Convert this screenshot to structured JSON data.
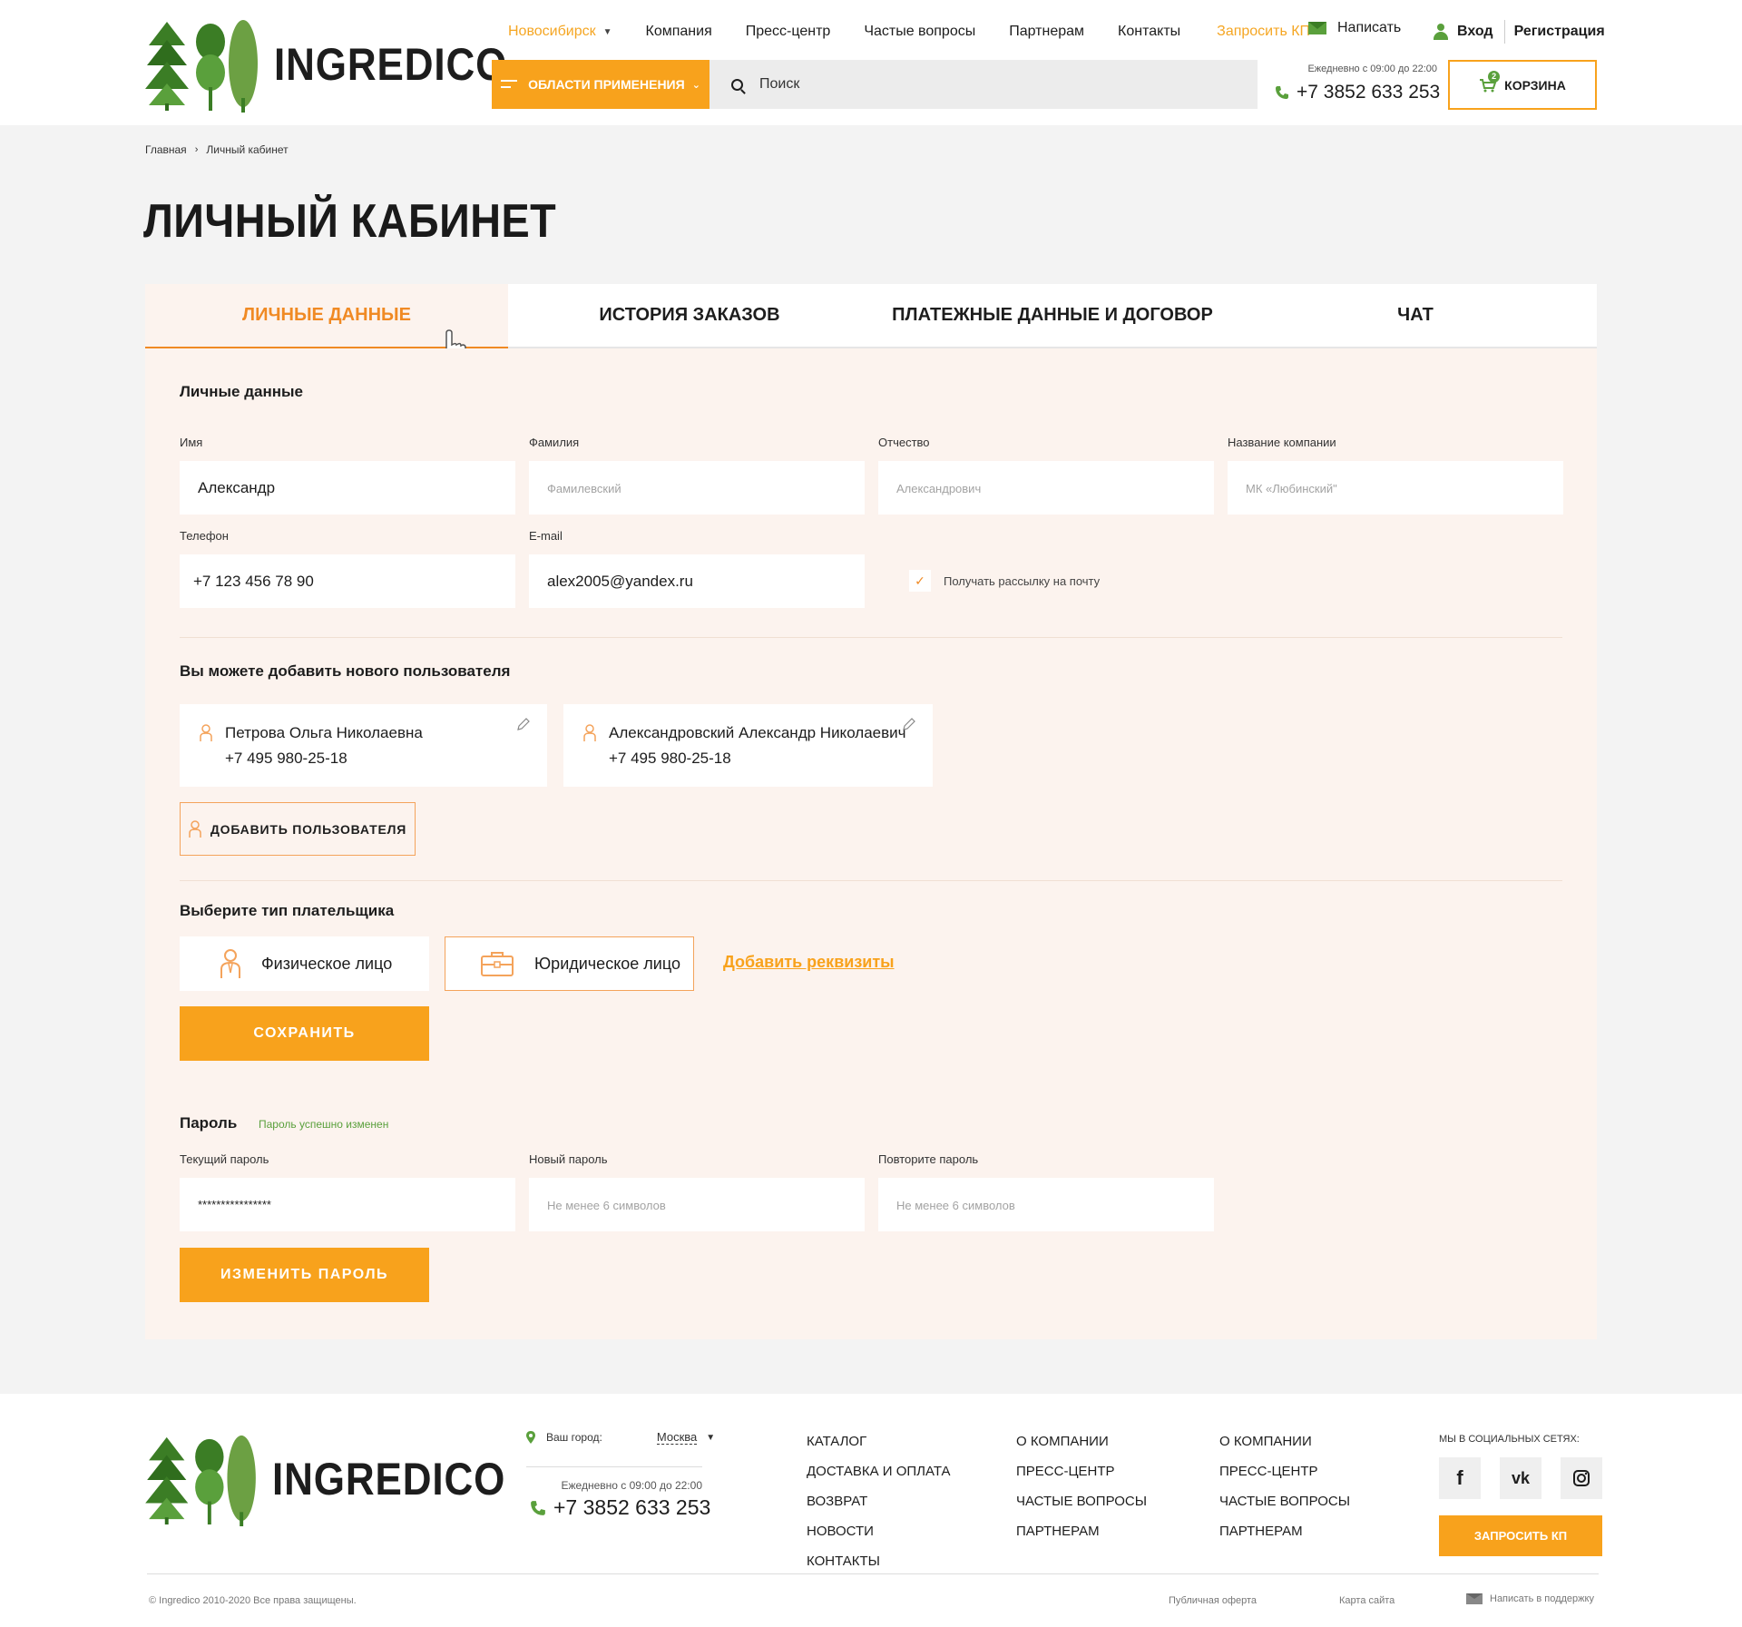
{
  "colors": {
    "accent": "#f8a21c",
    "accent_dark": "#f08a24",
    "green": "#5aa03c",
    "panel_bg": "#fcf3ee"
  },
  "header": {
    "logo_text": "INGREDICO",
    "city": "Новосибирск",
    "nav": [
      "Компания",
      "Пресс-центр",
      "Частые вопросы",
      "Партнерам",
      "Контакты"
    ],
    "request_kp": "Запросить КП",
    "write": "Написать",
    "login": "Вход",
    "register": "Регистрация",
    "areas_button": "ОБЛАСТИ ПРИМЕНЕНИЯ",
    "search_placeholder": "Поиск",
    "hours": "Ежедневно с 09:00 до 22:00",
    "phone": "+7 3852 633 253",
    "cart_label": "КОРЗИНА",
    "cart_count": "2"
  },
  "breadcrumb": {
    "home": "Главная",
    "current": "Личный кабинет"
  },
  "page_title": "ЛИЧНЫЙ КАБИНЕТ",
  "tabs": [
    "ЛИЧНЫЕ ДАННЫЕ",
    "ИСТОРИЯ ЗАКАЗОВ",
    "ПЛАТЕЖНЫЕ ДАННЫЕ И ДОГОВОР",
    "ЧАТ"
  ],
  "personal": {
    "title": "Личные данные",
    "fields": {
      "first_name": {
        "label": "Имя",
        "value": "Александр"
      },
      "last_name": {
        "label": "Фамилия",
        "placeholder": "Фамилевский"
      },
      "patronymic": {
        "label": "Отчество",
        "placeholder": "Александрович"
      },
      "company": {
        "label": "Название компании",
        "placeholder": "МК «Любинский\""
      },
      "phone": {
        "label": "Телефон",
        "value": "+7 123 456 78 90"
      },
      "email": {
        "label": "E-mail",
        "value": "alex2005@yandex.ru"
      }
    },
    "newsletter": "Получать рассылку на почту"
  },
  "users": {
    "title": "Вы можете добавить нового пользователя",
    "list": [
      {
        "name": "Петрова Ольга Николаевна",
        "phone": "+7 495 980-25-18"
      },
      {
        "name": "Александровский Александр Николаевич",
        "phone": "+7 495 980-25-18"
      }
    ],
    "add_button": "ДОБАВИТЬ ПОЛЬЗОВАТЕЛЯ"
  },
  "payer": {
    "title": "Выберите тип плательщика",
    "individual": "Физическое лицо",
    "legal": "Юридическое лицо",
    "add_requisites": "Добавить реквизиты",
    "save": "СОХРАНИТЬ"
  },
  "password": {
    "title": "Пароль",
    "status": "Пароль успешно изменен",
    "current": {
      "label": "Текущий пароль",
      "value": "****************"
    },
    "new": {
      "label": "Новый пароль",
      "placeholder": "Не менее 6 символов"
    },
    "repeat": {
      "label": "Повторите пароль",
      "placeholder": "Не менее 6 символов"
    },
    "change_button": "ИЗМЕНИТЬ ПАРОЛЬ"
  },
  "footer": {
    "logo_text": "INGREDICO",
    "city_label": "Ваш город:",
    "city": "Москва",
    "hours": "Ежедневно с 09:00 до 22:00",
    "phone": "+7 3852 633 253",
    "col1": [
      "КАТАЛОГ",
      "ДОСТАВКА И ОПЛАТА",
      "ВОЗВРАТ",
      "НОВОСТИ",
      "КОНТАКТЫ"
    ],
    "col2": [
      "О КОМПАНИИ",
      "ПРЕСС-ЦЕНТР",
      "ЧАСТЫЕ ВОПРОСЫ",
      "ПАРТНЕРАМ"
    ],
    "col3": [
      "О КОМПАНИИ",
      "ПРЕСС-ЦЕНТР",
      "ЧАСТЫЕ ВОПРОСЫ",
      "ПАРТНЕРАМ"
    ],
    "social_title": "МЫ В СОЦИАЛЬНЫХ СЕТЯХ:",
    "social": [
      "f",
      "vk",
      "instagram-icon"
    ],
    "request_kp": "ЗАПРОСИТЬ КП",
    "copyright": "© Ingredico 2010-2020 Все права защищены.",
    "offer": "Публичная оферта",
    "sitemap": "Карта сайта",
    "support": "Написать в поддержку"
  }
}
